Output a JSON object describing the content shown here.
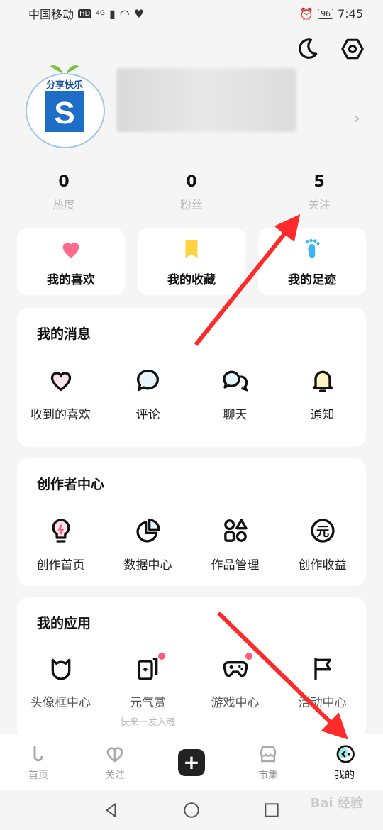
{
  "status": {
    "carrier": "中国移动",
    "hd": "HD",
    "net": "4G",
    "battery": "96",
    "time": "7:45"
  },
  "profile": {
    "avatar_text": "分享快乐"
  },
  "stats": [
    {
      "num": "0",
      "label": "热度"
    },
    {
      "num": "0",
      "label": "粉丝"
    },
    {
      "num": "5",
      "label": "关注"
    }
  ],
  "quick": [
    {
      "label": "我的喜欢",
      "icon": "heart-icon",
      "color": "#ff6b8b"
    },
    {
      "label": "我的收藏",
      "icon": "bookmark-icon",
      "color": "#ffd23f"
    },
    {
      "label": "我的足迹",
      "icon": "footprint-icon",
      "color": "#3fb6f0"
    }
  ],
  "messages": {
    "title": "我的消息",
    "items": [
      {
        "label": "收到的喜欢",
        "icon": "heart-outline-icon"
      },
      {
        "label": "评论",
        "icon": "comment-icon"
      },
      {
        "label": "聊天",
        "icon": "chat-icon"
      },
      {
        "label": "通知",
        "icon": "bell-icon"
      }
    ]
  },
  "creator": {
    "title": "创作者中心",
    "items": [
      {
        "label": "创作首页",
        "icon": "bulb-icon"
      },
      {
        "label": "数据中心",
        "icon": "pie-chart-icon"
      },
      {
        "label": "作品管理",
        "icon": "shapes-icon"
      },
      {
        "label": "创作收益",
        "icon": "yuan-icon"
      }
    ]
  },
  "apps": {
    "title": "我的应用",
    "items": [
      {
        "label": "头像框中心",
        "icon": "cat-icon",
        "sub": ""
      },
      {
        "label": "元气赏",
        "icon": "cards-icon",
        "sub": "快来一发入魂"
      },
      {
        "label": "游戏中心",
        "icon": "gamepad-icon",
        "sub": ""
      },
      {
        "label": "活动中心",
        "icon": "flag-icon",
        "sub": ""
      }
    ]
  },
  "tabs": [
    {
      "label": "首页",
      "icon": "home-icon"
    },
    {
      "label": "关注",
      "icon": "follow-icon"
    },
    {
      "label": "",
      "icon": "plus-icon"
    },
    {
      "label": "市集",
      "icon": "store-icon"
    },
    {
      "label": "我的",
      "icon": "me-icon"
    }
  ],
  "watermark": "Bai 经验",
  "colors": {
    "accent": "#ff2a2a",
    "tab_active": "#111111",
    "muted": "#bbbbbb"
  }
}
